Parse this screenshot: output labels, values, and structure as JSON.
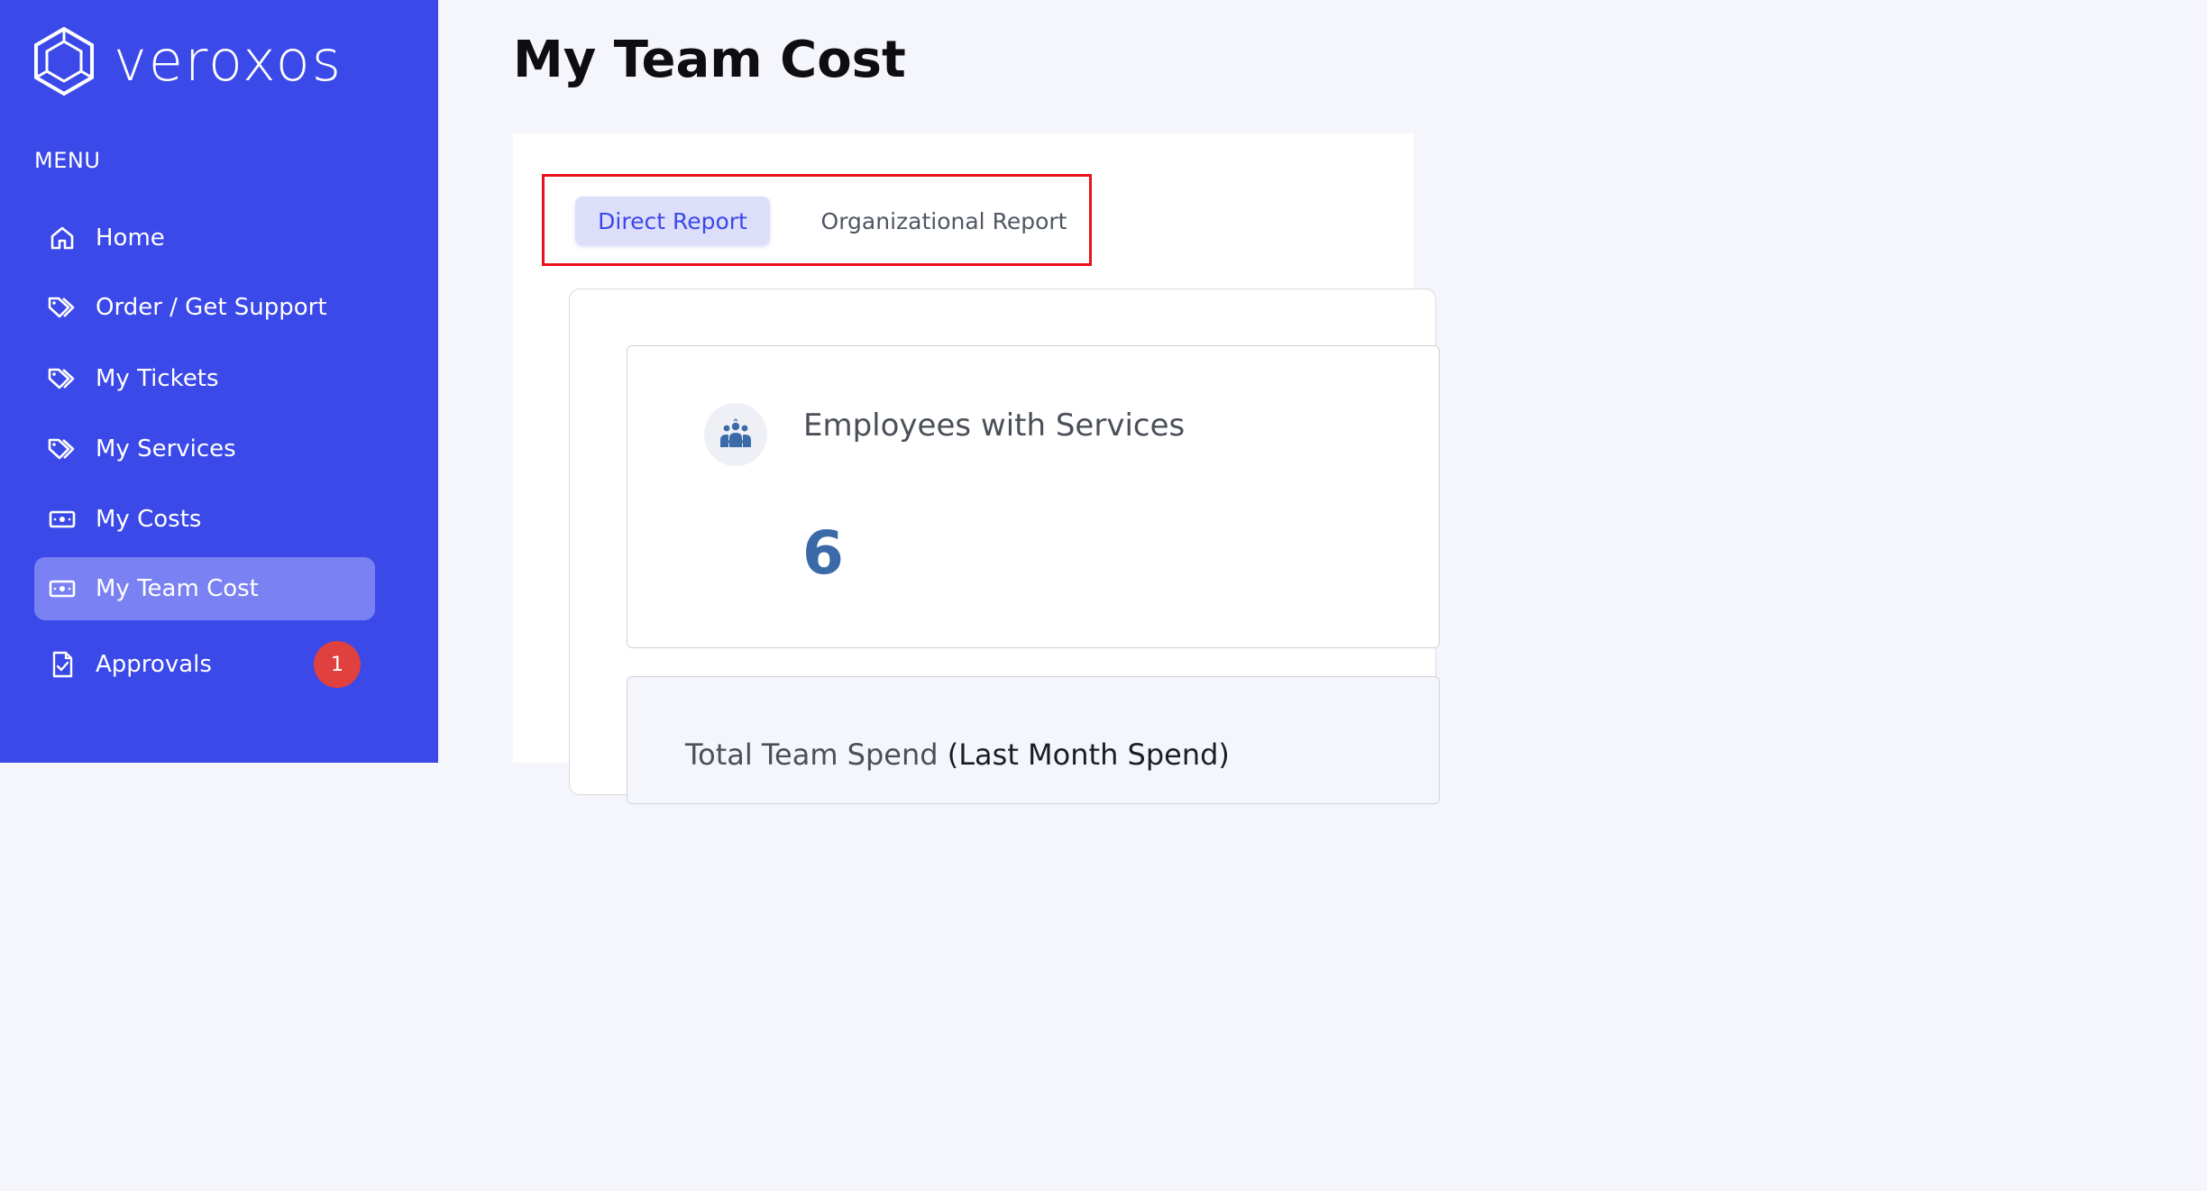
{
  "brand": {
    "name": "veroxos",
    "logo_icon": "hexagon-cube-icon"
  },
  "sidebar": {
    "menu_heading": "MENU",
    "items": [
      {
        "label": "Home",
        "icon": "home-icon"
      },
      {
        "label": "Order / Get Support",
        "icon": "tags-icon"
      },
      {
        "label": "My Tickets",
        "icon": "tags-icon"
      },
      {
        "label": "My Services",
        "icon": "tags-icon"
      },
      {
        "label": "My Costs",
        "icon": "money-icon"
      },
      {
        "label": "My Team Cost",
        "icon": "money-icon",
        "active": true
      },
      {
        "label": "Approvals",
        "icon": "document-check-icon",
        "badge": "1"
      }
    ]
  },
  "page": {
    "title": "My Team Cost"
  },
  "tabs": [
    {
      "label": "Direct Report",
      "active": true
    },
    {
      "label": "Organizational Report",
      "active": false
    }
  ],
  "stats": {
    "employees_label": "Employees with Services",
    "employees_value": "6",
    "employees_icon": "team-icon",
    "spend_label": "Total Team Spend",
    "spend_sublabel": "(Last Month Spend)"
  },
  "colors": {
    "sidebar_bg": "#3b49e8",
    "active_item_bg": "#7a81f2",
    "badge": "#e0403e",
    "highlight_border": "#e8121c",
    "stat_value": "#3a6aa8"
  }
}
